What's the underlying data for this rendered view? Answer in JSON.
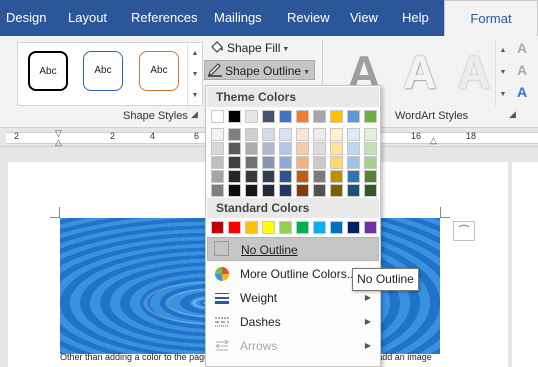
{
  "tabs": [
    {
      "label": "Design",
      "active": false
    },
    {
      "label": "Layout",
      "active": false
    },
    {
      "label": "References",
      "active": false
    },
    {
      "label": "Mailings",
      "active": false
    },
    {
      "label": "Review",
      "active": false
    },
    {
      "label": "View",
      "active": false
    },
    {
      "label": "Help",
      "active": false
    },
    {
      "label": "Format",
      "active": true
    }
  ],
  "ribbon": {
    "shape_style_thumbs": [
      "Abc",
      "Abc",
      "Abc"
    ],
    "shape_fill_label": "Shape Fill",
    "shape_outline_label": "Shape Outline",
    "shape_styles_group": "Shape Styles",
    "wordart_styles_group": "WordArt Styles",
    "wordart_thumbs": [
      "A",
      "A",
      "A"
    ],
    "text_fill_glyph": "A",
    "text_outline_glyph": "A",
    "text_effects_glyph": "A"
  },
  "ruler": {
    "numbers": [
      "2",
      "2",
      "4",
      "6",
      "8",
      "10",
      "12",
      "14",
      "16",
      "18"
    ]
  },
  "document": {
    "visible_text": "Other than adding a color to the page background in the word file, you can also add an image"
  },
  "menu": {
    "theme_colors_header": "Theme Colors",
    "standard_colors_header": "Standard Colors",
    "theme_colors_top": [
      "#ffffff",
      "#000000",
      "#e7e6e6",
      "#44546a",
      "#4472c4",
      "#ed7d31",
      "#a5a5a5",
      "#ffc000",
      "#5b9bd5",
      "#70ad47"
    ],
    "theme_colors_shades": [
      [
        "#f2f2f2",
        "#7f7f7f",
        "#d0cece",
        "#d6dce4",
        "#d9e2f3",
        "#fbe5d5",
        "#ededed",
        "#fff2cc",
        "#deebf6",
        "#e2efd9"
      ],
      [
        "#d8d8d8",
        "#595959",
        "#aeabab",
        "#adb9ca",
        "#b4c6e7",
        "#f7cbac",
        "#dbdbdb",
        "#fee599",
        "#bdd7ee",
        "#c5e0b3"
      ],
      [
        "#bfbfbf",
        "#3f3f3f",
        "#757070",
        "#8496b0",
        "#8eaadb",
        "#f4b183",
        "#c9c9c9",
        "#ffd965",
        "#9cc3e5",
        "#a8d08d"
      ],
      [
        "#a5a5a5",
        "#262626",
        "#3a3838",
        "#323f4f",
        "#2f5496",
        "#c55a11",
        "#7b7b7b",
        "#bf8f00",
        "#2e75b5",
        "#538135"
      ],
      [
        "#7f7f7f",
        "#0c0c0c",
        "#171616",
        "#222a35",
        "#1f3864",
        "#833c0b",
        "#525252",
        "#7f6000",
        "#1e4e79",
        "#375623"
      ]
    ],
    "standard_colors": [
      "#c00000",
      "#ff0000",
      "#ffc000",
      "#ffff00",
      "#92d050",
      "#00b050",
      "#00b0f0",
      "#0070c0",
      "#002060",
      "#7030a0"
    ],
    "items": {
      "no_outline": "No Outline",
      "more_colors": "More Outline Colors...",
      "weight": "Weight",
      "dashes": "Dashes",
      "arrows": "Arrows"
    }
  },
  "tooltip": {
    "text": "No Outline"
  }
}
